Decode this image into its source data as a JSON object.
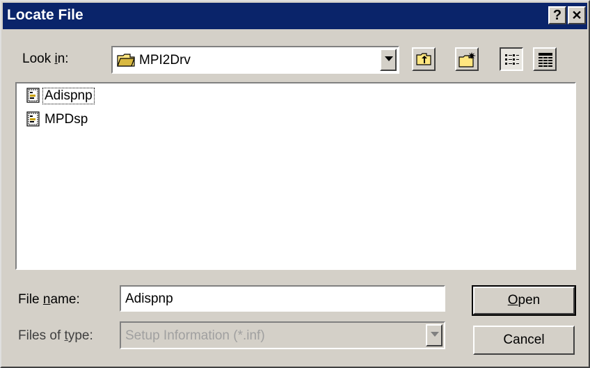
{
  "window": {
    "title": "Locate File",
    "help_glyph": "?",
    "close_glyph": "✕"
  },
  "look_in": {
    "label_pre": "Look ",
    "label_accel": "i",
    "label_post": "n:",
    "value": "MPI2Drv",
    "icon": "folder-icon"
  },
  "toolbar": {
    "up_one_level": "up-folder-icon",
    "new_folder": "new-folder-icon",
    "list_view": "list-view-icon",
    "details_view": "details-view-icon"
  },
  "files": [
    {
      "name": "Adispnp",
      "icon": "setup-info-file-icon",
      "focused": true
    },
    {
      "name": "MPDsp",
      "icon": "setup-info-file-icon",
      "focused": false
    }
  ],
  "file_name": {
    "label_pre": "File ",
    "label_accel": "n",
    "label_post": "ame:",
    "value": "Adispnp"
  },
  "file_type": {
    "label_pre": "Files of ",
    "label_accel": "t",
    "label_post": "ype:",
    "value": "Setup Information (*.inf)"
  },
  "buttons": {
    "open_accel": "O",
    "open_rest": "pen",
    "cancel": "Cancel"
  },
  "colors": {
    "titlebar": "#0a246a",
    "face": "#d4d0c8"
  }
}
